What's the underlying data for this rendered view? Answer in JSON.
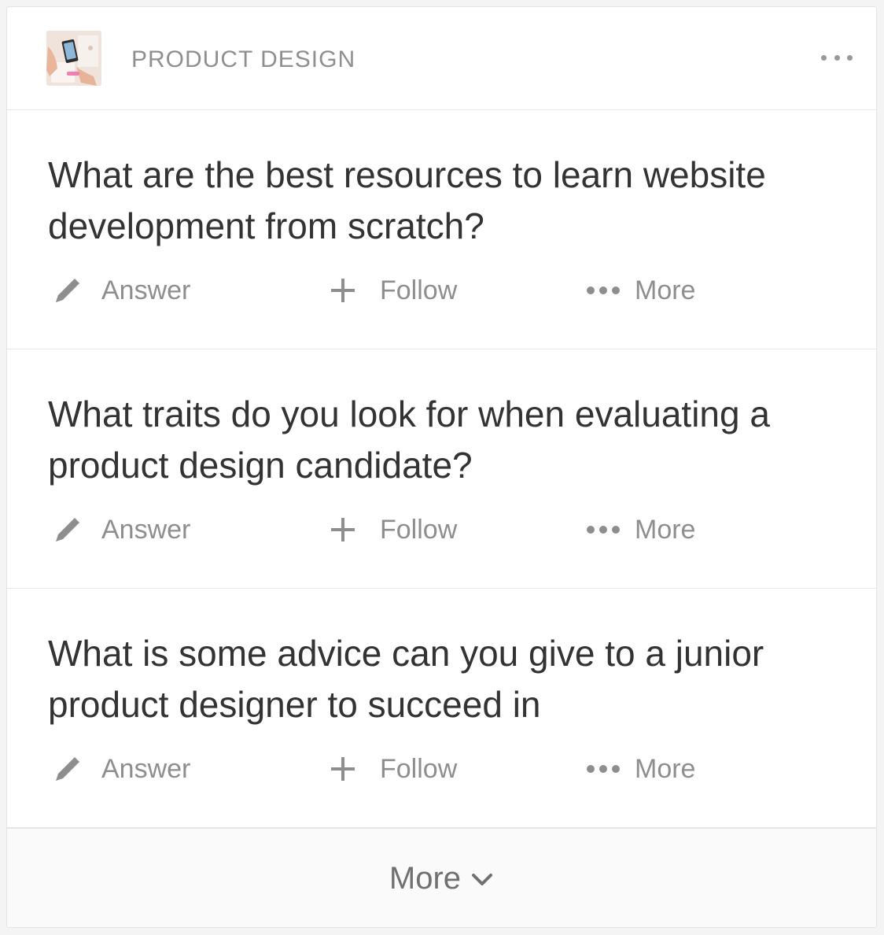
{
  "topic": {
    "title": "PRODUCT DESIGN",
    "thumbnail_icon": "topic-thumbnail",
    "menu_icon": "ellipsis-icon"
  },
  "questions": [
    {
      "title": "What are the best resources to learn website development from scratch?",
      "actions": {
        "answer": "Answer",
        "follow": "Follow",
        "more": "More"
      }
    },
    {
      "title": "What traits do you look for when evaluating a product design candidate?",
      "actions": {
        "answer": "Answer",
        "follow": "Follow",
        "more": "More"
      }
    },
    {
      "title": "What is some advice can you give to a junior product designer to succeed in",
      "actions": {
        "answer": "Answer",
        "follow": "Follow",
        "more": "More"
      }
    }
  ],
  "footer": {
    "more_label": "More",
    "chevron_icon": "chevron-down-icon"
  },
  "colors": {
    "text_primary": "#333333",
    "text_secondary": "#8e8e8e",
    "border": "#e6e6e6",
    "footer_bg": "#fafafa"
  }
}
